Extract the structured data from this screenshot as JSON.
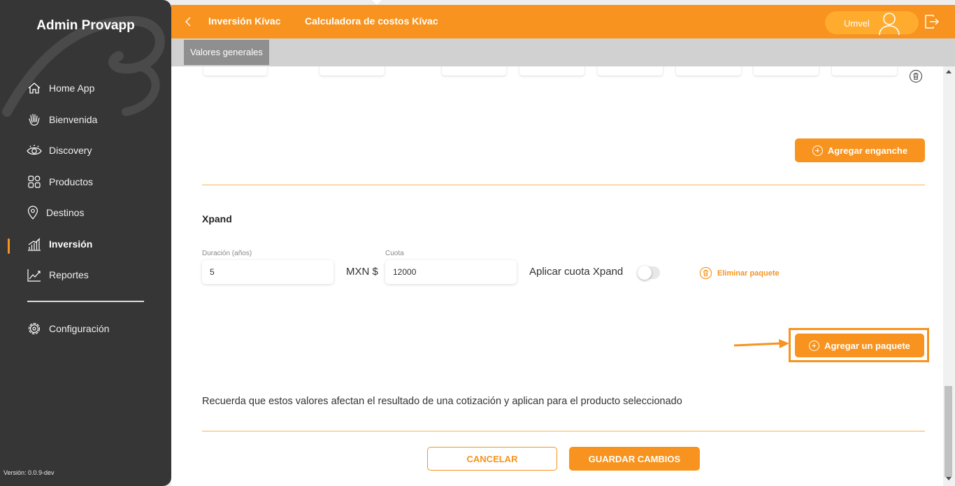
{
  "app": {
    "title": "Admin Provapp",
    "version": "Versión: 0.0.9-dev"
  },
  "sidebar": {
    "items": [
      {
        "label": "Home App",
        "icon": "home-icon"
      },
      {
        "label": "Bienvenida",
        "icon": "waving-hand-icon"
      },
      {
        "label": "Discovery",
        "icon": "eye-icon"
      },
      {
        "label": "Productos",
        "icon": "grid-icon"
      },
      {
        "label": "Destinos",
        "icon": "map-pin-icon"
      },
      {
        "label": "Inversión",
        "icon": "bar-chart-icon",
        "active": true
      },
      {
        "label": "Reportes",
        "icon": "line-chart-icon"
      },
      {
        "label": "Configuración",
        "icon": "gear-icon"
      }
    ]
  },
  "header": {
    "breadcrumb_1": "Inversión Kívac",
    "breadcrumb_2": "Calculadora de costos Kívac",
    "user_name": "Umvel"
  },
  "tabs": {
    "active": "Valores generales"
  },
  "enganche": {
    "add_button": "Agregar enganche"
  },
  "xpand": {
    "title": "Xpand",
    "duration_label": "Duración (años)",
    "duration_value": "5",
    "currency": "MXN $",
    "fee_label": "Cuota",
    "fee_value": "12000",
    "apply_fee_label": "Aplicar cuota Xpand",
    "apply_fee_enabled": false,
    "delete_package": "Eliminar paquete"
  },
  "add_package_button": "Agregar un paquete",
  "note": "Recuerda que estos valores afectan el resultado de una cotización y aplican para el producto seleccionado",
  "actions": {
    "cancel": "CANCELAR",
    "save": "GUARDAR CAMBIOS"
  },
  "colors": {
    "accent": "#f7931e",
    "sidebar": "#363636"
  }
}
